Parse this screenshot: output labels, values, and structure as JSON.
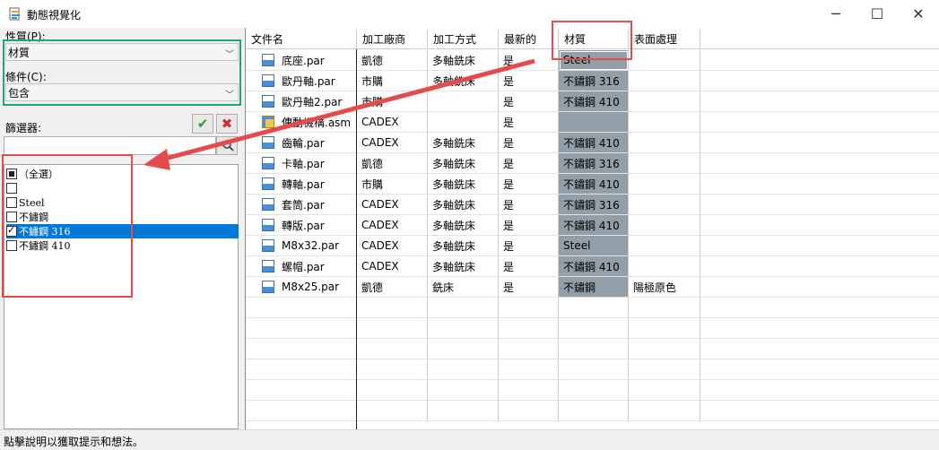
{
  "window": {
    "title": "動態視覺化",
    "minimize": "─",
    "maximize": "☐",
    "close": "✕"
  },
  "left_panel": {
    "property_label": "性質(P):",
    "property_value": "材質",
    "condition_label": "條件(C):",
    "condition_value": "包含",
    "filter_label": "篩選器:",
    "filter_input_value": "",
    "apply_icon": "✔",
    "clear_icon": "✖",
    "search_icon": "🔍",
    "filter_items": [
      {
        "label": "（全選）",
        "state": "partial"
      },
      {
        "label": "",
        "state": "unchecked"
      },
      {
        "label": "Steel",
        "state": "unchecked"
      },
      {
        "label": "不鏽鋼",
        "state": "unchecked"
      },
      {
        "label": "不鏽鋼 316",
        "state": "checked",
        "selected": true
      },
      {
        "label": "不鏽鋼 410",
        "state": "unchecked"
      }
    ]
  },
  "grid": {
    "columns": [
      "文件名",
      "加工廠商",
      "加工方式",
      "最新的",
      "材質",
      "表面處理"
    ],
    "rows": [
      {
        "icon": "part-icon",
        "file": "底座.par",
        "vendor": "凱德",
        "method": "多軸銑床",
        "latest": "是",
        "material": "Steel",
        "surface": ""
      },
      {
        "icon": "part-icon",
        "file": "歐丹軸.par",
        "vendor": "市購",
        "method": "多軸銑床",
        "latest": "是",
        "material": "不鏽鋼 316",
        "surface": ""
      },
      {
        "icon": "part-icon",
        "file": "歐丹軸2.par",
        "vendor": "市購",
        "method": "",
        "latest": "是",
        "material": "不鏽鋼 410",
        "surface": ""
      },
      {
        "icon": "assembly-icon",
        "file": "傳動機構.asm",
        "vendor": "CADEX",
        "method": "",
        "latest": "是",
        "material": "",
        "surface": ""
      },
      {
        "icon": "part-icon",
        "file": "齒輪.par",
        "vendor": "CADEX",
        "method": "多軸銑床",
        "latest": "是",
        "material": "不鏽鋼 410",
        "surface": ""
      },
      {
        "icon": "part-icon",
        "file": "卡軸.par",
        "vendor": "凱德",
        "method": "多軸銑床",
        "latest": "是",
        "material": "不鏽鋼 316",
        "surface": ""
      },
      {
        "icon": "part-icon",
        "file": "轉軸.par",
        "vendor": "市購",
        "method": "多軸銑床",
        "latest": "是",
        "material": "不鏽鋼 410",
        "surface": ""
      },
      {
        "icon": "part-icon",
        "file": "套筒.par",
        "vendor": "CADEX",
        "method": "多軸銑床",
        "latest": "是",
        "material": "不鏽鋼 316",
        "surface": ""
      },
      {
        "icon": "part-icon",
        "file": "轉版.par",
        "vendor": "CADEX",
        "method": "多軸銑床",
        "latest": "是",
        "material": "不鏽鋼 410",
        "surface": ""
      },
      {
        "icon": "part-icon",
        "file": "M8x32.par",
        "vendor": "CADEX",
        "method": "多軸銑床",
        "latest": "是",
        "material": "Steel",
        "surface": ""
      },
      {
        "icon": "part-icon",
        "file": "螺帽.par",
        "vendor": "CADEX",
        "method": "多軸銑床",
        "latest": "是",
        "material": "不鏽鋼 410",
        "surface": ""
      },
      {
        "icon": "part-icon",
        "file": "M8x25.par",
        "vendor": "凱德",
        "method": "銑床",
        "latest": "是",
        "material": "不鏽鋼",
        "surface": "陽極原色"
      }
    ]
  },
  "status_bar": {
    "text": "點擊說明以獲取提示和想法。"
  },
  "colors": {
    "annotation_red": "#e54b4b",
    "annotation_green": "#1aa585",
    "selection_blue": "#0078d7",
    "material_column": "#929fa8"
  }
}
